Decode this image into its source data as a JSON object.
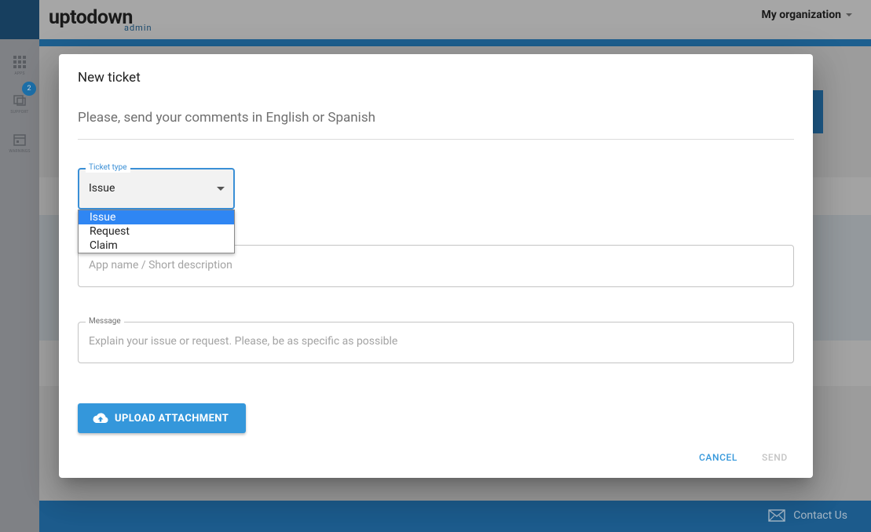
{
  "header": {
    "logo_main": "uptodown",
    "logo_sub": "admin",
    "organization": "My organization"
  },
  "sidebar": {
    "items": [
      {
        "label": "APPS",
        "icon": "grid-icon"
      },
      {
        "label": "SUPPORT",
        "icon": "support-icon",
        "badge": "2"
      },
      {
        "label": "WARNINGS",
        "icon": "calendar-icon"
      }
    ]
  },
  "footer": {
    "contact_label": "Contact Us"
  },
  "dialog": {
    "title": "New ticket",
    "subtitle": "Please, send your comments in English or Spanish",
    "ticket_type": {
      "label": "Ticket type",
      "value": "Issue",
      "options": [
        "Issue",
        "Request",
        "Claim"
      ],
      "selected_index": 0
    },
    "subject": {
      "placeholder": "App name / Short description"
    },
    "message": {
      "label": "Message",
      "placeholder": "Explain your issue or request. Please, be as specific as possible"
    },
    "upload_label": "UPLOAD ATTACHMENT",
    "cancel_label": "CANCEL",
    "send_label": "SEND"
  },
  "colors": {
    "accent": "#3497db",
    "focus": "#3a8fd6",
    "selected_option": "#2f86f3",
    "footer": "#1c5b8c"
  }
}
